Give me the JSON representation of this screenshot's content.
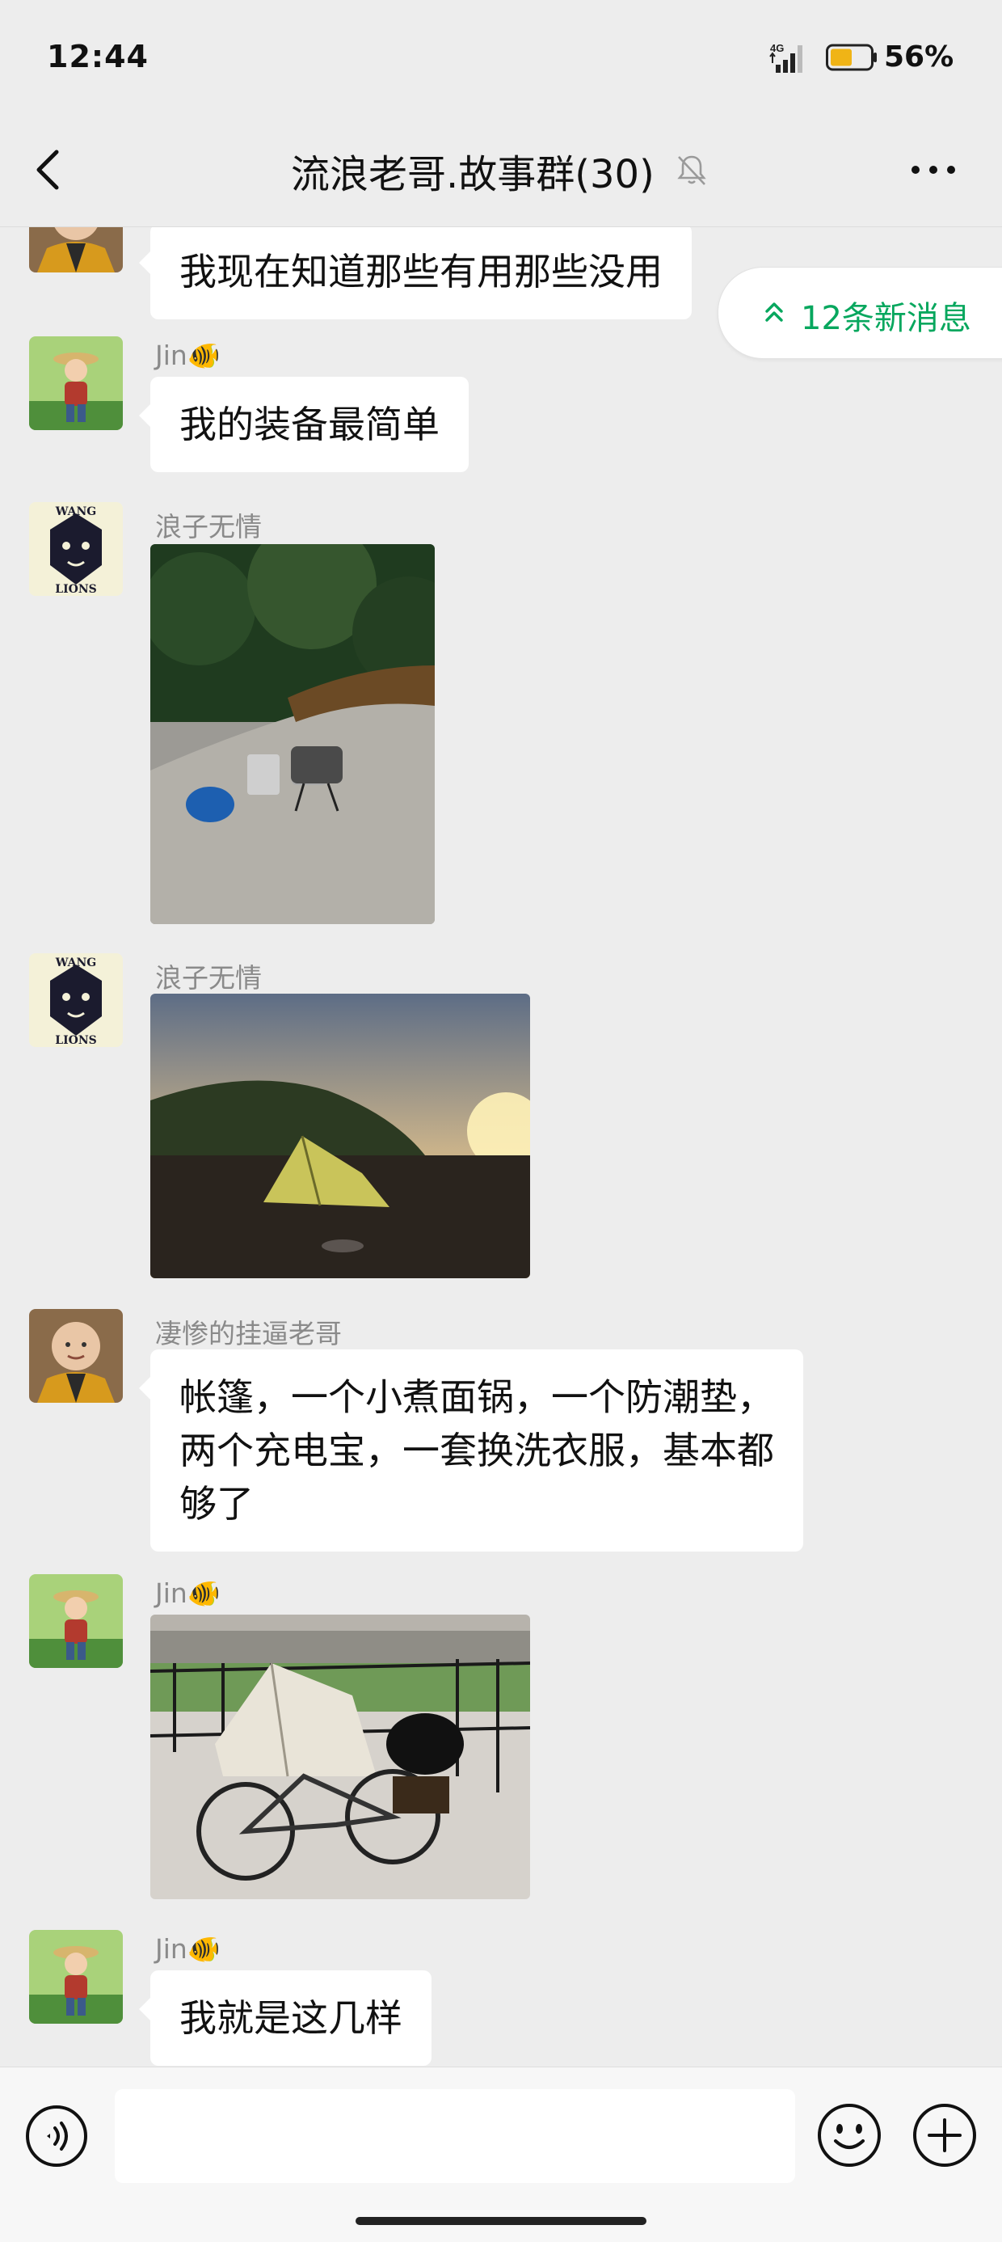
{
  "status_bar": {
    "time": "12:44",
    "network": "4G",
    "battery_percent": "56%",
    "battery_level": 0.56
  },
  "header": {
    "title": "流浪老哥.故事群(30)",
    "muted": true
  },
  "new_messages": {
    "label": "12条新消息"
  },
  "messages": [
    {
      "type": "text",
      "sender": "",
      "avatar": "monk-avatar",
      "text": "我现在知道那些有用那些没用"
    },
    {
      "type": "text",
      "sender": "Jin🐠",
      "avatar": "boy-avatar",
      "text": "我的装备最简单"
    },
    {
      "type": "image",
      "sender": "浪子无情",
      "avatar": "lion-avatar",
      "image": "camping-stove-photo"
    },
    {
      "type": "image",
      "sender": "浪子无情",
      "avatar": "lion-avatar",
      "image": "tent-sunset-photo"
    },
    {
      "type": "text",
      "sender": "凄惨的挂逼老哥",
      "avatar": "monk-avatar",
      "lines": [
        "帐篷，一个小煮面锅，一个防潮垫，",
        "两个充电宝，一套换洗衣服，基本都",
        "够了"
      ]
    },
    {
      "type": "image",
      "sender": "Jin🐠",
      "avatar": "boy-avatar",
      "image": "bicycle-tent-photo"
    },
    {
      "type": "text",
      "sender": "Jin🐠",
      "avatar": "boy-avatar",
      "text": "我就是这几样"
    }
  ],
  "input_bar": {
    "value": "",
    "icons": [
      "voice-icon",
      "emoji-icon",
      "plus-icon"
    ]
  },
  "colors": {
    "background": "#ededed",
    "bubble": "#ffffff",
    "accent_green": "#07a75e",
    "battery_fill": "#f0b416"
  }
}
